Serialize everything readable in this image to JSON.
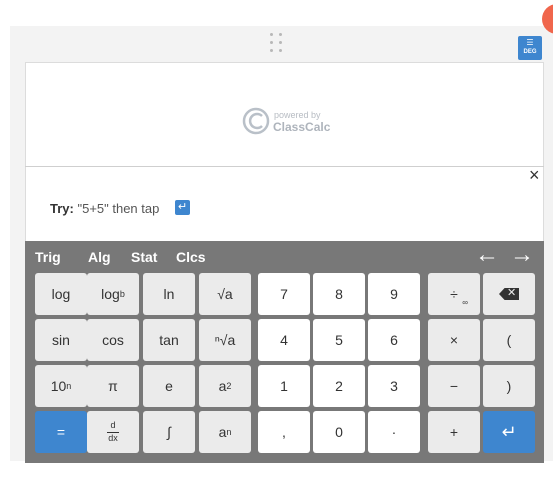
{
  "logo": {
    "powered_by": "powered by",
    "brand": "ClassCalc"
  },
  "mode_button": {
    "label": "DEG",
    "icon": "settings-sliders-icon"
  },
  "hint": {
    "prefix": "Try:",
    "text": "\"5+5\" then tap",
    "icon": "enter-icon"
  },
  "close_label": "×",
  "tabs": [
    "Trig",
    "Alg",
    "Stat",
    "Clcs"
  ],
  "nav": {
    "left": "←",
    "right": "→"
  },
  "keys": {
    "log": "log",
    "logb_base": "log",
    "logb_sub": "b",
    "ln": "ln",
    "sqrt": "√a",
    "sin": "sin",
    "cos": "cos",
    "tan": "tan",
    "nthroot": "ⁿ√a",
    "tenpow_base": "10",
    "tenpow_exp": "n",
    "pi": "π",
    "e": "e",
    "square_base": "a",
    "square_exp": "2",
    "equals": "=",
    "deriv_top": "d",
    "deriv_bottom": "dx",
    "integral": "∫",
    "power_base": "a",
    "power_exp": "n",
    "n7": "7",
    "n8": "8",
    "n9": "9",
    "n4": "4",
    "n5": "5",
    "n6": "6",
    "n1": "1",
    "n2": "2",
    "n3": "3",
    "comma": ",",
    "n0": "0",
    "dot": "·",
    "divide": "÷",
    "divide_sub": "∞",
    "backspace": "✕",
    "times": "×",
    "lparen": "(",
    "minus": "−",
    "rparen": ")",
    "plus": "+",
    "enter": "↵"
  },
  "colors": {
    "accent": "#3e86cf",
    "keyboard_bg": "#787878",
    "notification": "#f0664c"
  }
}
